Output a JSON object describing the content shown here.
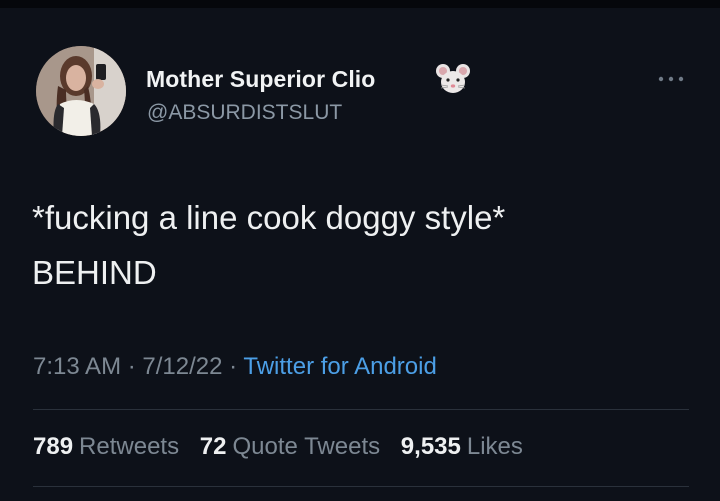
{
  "tweet": {
    "display_name": "Mother Superior Clio",
    "name_emoji": "mouse-face-emoji",
    "handle": "@ABSURDISTSLUT",
    "text_line1": "*fucking a line cook doggy style*",
    "text_line2": "BEHIND",
    "time": "7:13 AM",
    "date": "7/12/22",
    "separator": "·",
    "source": "Twitter for Android",
    "stats": {
      "retweets_count": "789",
      "retweets_label": "Retweets",
      "quotes_count": "72",
      "quotes_label": "Quote Tweets",
      "likes_count": "9,535",
      "likes_label": "Likes"
    }
  },
  "colors": {
    "background": "#0d1119",
    "text_primary": "#eef0f1",
    "text_secondary": "#7d8893",
    "link_blue": "#4c9fe6"
  }
}
